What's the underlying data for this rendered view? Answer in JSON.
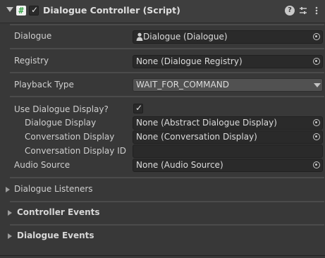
{
  "header": {
    "title": "Dialogue Controller (Script)",
    "enabled_check": "✓",
    "icon_glyph": "#"
  },
  "fields": {
    "dialogue": {
      "label": "Dialogue",
      "value": "Dialogue (Dialogue)"
    },
    "registry": {
      "label": "Registry",
      "value": "None (Dialogue Registry)"
    },
    "playback": {
      "label": "Playback Type",
      "value": "WAIT_FOR_COMMAND"
    },
    "use_display": {
      "label": "Use Dialogue Display?",
      "check": "✓"
    },
    "dialogue_display": {
      "label": "Dialogue Display",
      "value": "None (Abstract Dialogue Display)"
    },
    "conversation_display": {
      "label": "Conversation Display",
      "value": "None (Conversation Display)"
    },
    "conversation_display_id": {
      "label": "Conversation Display ID",
      "value": ""
    },
    "audio_source": {
      "label": "Audio Source",
      "value": "None (Audio Source)"
    }
  },
  "sections": {
    "listeners": "Dialogue Listeners",
    "controller_events": "Controller Events",
    "dialogue_events": "Dialogue Events"
  },
  "icons": [
    "foldout-arrow",
    "script-icon",
    "help-icon",
    "presets-icon",
    "more-icon",
    "object-picker-icon",
    "dropdown-caret-icon",
    "person-icon"
  ]
}
